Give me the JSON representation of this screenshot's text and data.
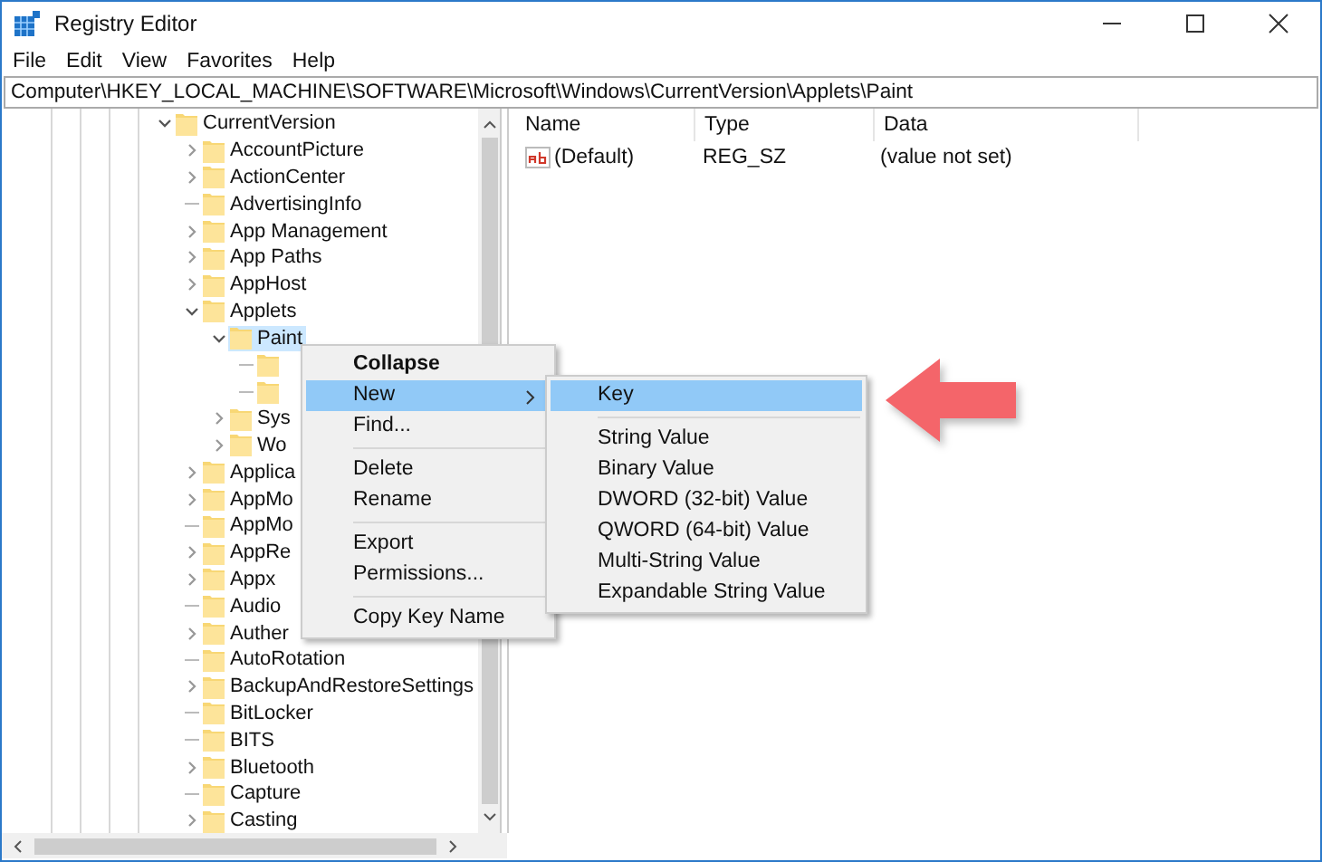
{
  "window": {
    "title": "Registry Editor"
  },
  "menu_bar": [
    "File",
    "Edit",
    "View",
    "Favorites",
    "Help"
  ],
  "address_bar": {
    "value": "Computer\\HKEY_LOCAL_MACHINE\\SOFTWARE\\Microsoft\\Windows\\CurrentVersion\\Applets\\Paint"
  },
  "tree": [
    {
      "label": "CurrentVersion",
      "expanded": true,
      "selected": false,
      "children": [
        {
          "label": "AccountPicture",
          "expanded": false,
          "selected": false
        },
        {
          "label": "ActionCenter",
          "expanded": false,
          "selected": false
        },
        {
          "label": "AdvertisingInfo",
          "selected": false
        },
        {
          "label": "App Management",
          "expanded": false,
          "selected": false
        },
        {
          "label": "App Paths",
          "expanded": false,
          "selected": false
        },
        {
          "label": "AppHost",
          "expanded": false,
          "selected": false
        },
        {
          "label": "Applets",
          "expanded": true,
          "selected": false,
          "children": [
            {
              "label": "Paint",
              "expanded": true,
              "selected": true,
              "children": [
                {
                  "selected": false
                },
                {
                  "selected": false
                }
              ]
            },
            {
              "label": "Sys",
              "expanded": false,
              "selected": false
            },
            {
              "label": "Wo",
              "expanded": false,
              "selected": false
            }
          ]
        },
        {
          "label": "Applica",
          "expanded": false,
          "selected": false
        },
        {
          "label": "AppMo",
          "expanded": false,
          "selected": false
        },
        {
          "label": "AppMo",
          "selected": false
        },
        {
          "label": "AppRe",
          "expanded": false,
          "selected": false
        },
        {
          "label": "Appx",
          "expanded": false,
          "selected": false
        },
        {
          "label": "Audio",
          "selected": false
        },
        {
          "label": "Auther",
          "expanded": false,
          "selected": false
        },
        {
          "label": "AutoRotation",
          "selected": false
        },
        {
          "label": "BackupAndRestoreSettings",
          "expanded": false,
          "selected": false
        },
        {
          "label": "BitLocker",
          "selected": false
        },
        {
          "label": "BITS",
          "selected": false
        },
        {
          "label": "Bluetooth",
          "expanded": false,
          "selected": false
        },
        {
          "label": "Capture",
          "selected": false
        },
        {
          "label": "Casting",
          "expanded": false,
          "selected": false
        }
      ]
    }
  ],
  "values_table": {
    "columns": [
      "Name",
      "Type",
      "Data"
    ],
    "rows": [
      {
        "name": "(Default)",
        "type": "REG_SZ",
        "data": "(value not set)"
      }
    ]
  },
  "context_menu": {
    "items": [
      {
        "kind": "item",
        "label": "Collapse",
        "default": true,
        "highlighted": false,
        "has_submenu": false
      },
      {
        "kind": "item",
        "label": "New",
        "default": false,
        "highlighted": true,
        "has_submenu": true
      },
      {
        "kind": "item",
        "label": "Find...",
        "default": false,
        "highlighted": false,
        "has_submenu": false
      },
      {
        "kind": "separator"
      },
      {
        "kind": "item",
        "label": "Delete",
        "default": false,
        "highlighted": false,
        "has_submenu": false
      },
      {
        "kind": "item",
        "label": "Rename",
        "default": false,
        "highlighted": false,
        "has_submenu": false
      },
      {
        "kind": "separator"
      },
      {
        "kind": "item",
        "label": "Export",
        "default": false,
        "highlighted": false,
        "has_submenu": false
      },
      {
        "kind": "item",
        "label": "Permissions...",
        "default": false,
        "highlighted": false,
        "has_submenu": false
      },
      {
        "kind": "separator"
      },
      {
        "kind": "item",
        "label": "Copy Key Name",
        "default": false,
        "highlighted": false,
        "has_submenu": false
      }
    ]
  },
  "submenu": {
    "items": [
      {
        "kind": "item",
        "label": "Key",
        "default": false,
        "highlighted": true,
        "has_submenu": false
      },
      {
        "kind": "separator"
      },
      {
        "kind": "item",
        "label": "String Value",
        "default": false,
        "highlighted": false,
        "has_submenu": false
      },
      {
        "kind": "item",
        "label": "Binary Value",
        "default": false,
        "highlighted": false,
        "has_submenu": false
      },
      {
        "kind": "item",
        "label": "DWORD (32-bit) Value",
        "default": false,
        "highlighted": false,
        "has_submenu": false
      },
      {
        "kind": "item",
        "label": "QWORD (64-bit) Value",
        "default": false,
        "highlighted": false,
        "has_submenu": false
      },
      {
        "kind": "item",
        "label": "Multi-String Value",
        "default": false,
        "highlighted": false,
        "has_submenu": false
      },
      {
        "kind": "item",
        "label": "Expandable String Value",
        "default": false,
        "highlighted": false,
        "has_submenu": false
      }
    ]
  }
}
